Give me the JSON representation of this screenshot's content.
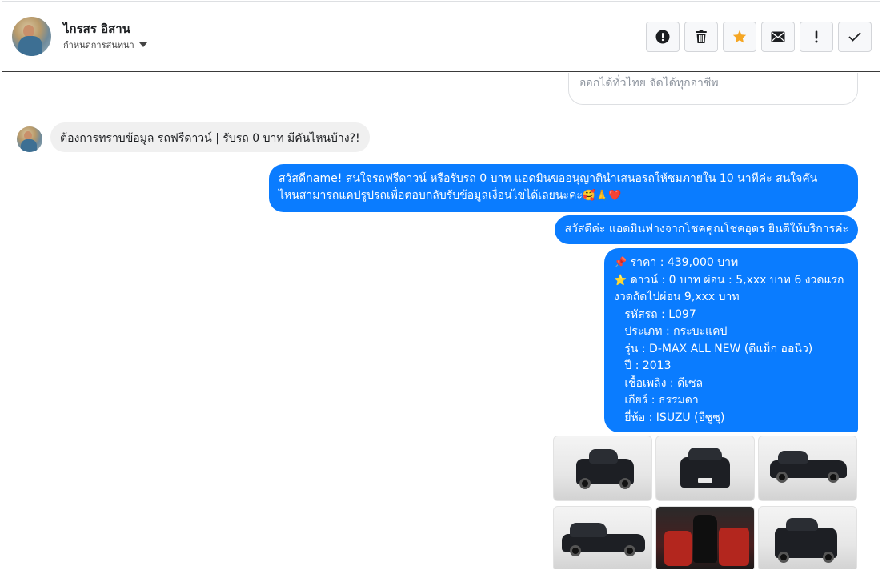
{
  "header": {
    "contact_name": "ไกรสร อิสาน",
    "subtitle": "กำหนดการสนทนา",
    "icons": [
      "alert-circle-icon",
      "trash-icon",
      "star-icon",
      "mail-icon",
      "exclamation-icon",
      "check-icon"
    ],
    "colors": {
      "star": "#f5a623",
      "icon": "#1c1e21"
    }
  },
  "thread": {
    "card_text": "ออกได้ทั่วไทย จัดได้ทุกอาชีพ",
    "incoming": "ต้องการทราบข้อมูล รถฟรีดาวน์ | รับรถ 0 บาท มีคันไหนบ้าง?!",
    "outgoing_1_line1": "สวัสดีname! สนใจรถฟรีดาวน์ หรือรับรถ 0 บาท แอดมินขออนุญาตินำเสนอรถให้ชมภายใน 10 นาทีค่ะ สนใจคัน",
    "outgoing_1_line2": "ไหนสามารถแคปรูปรถเพื่อตอบกลับรับข้อมูลเงื่อนไขได้เลยนะคะ",
    "outgoing_1_emoji": "🥰🙏❤️",
    "outgoing_2": "สวัสดีค่ะ แอดมินฟางจากโชคคูณโชคอุดร ยินดีให้บริการค่ะ",
    "outgoing_3": {
      "pin_emoji": "📌",
      "star_emoji": "⭐",
      "price": " ราคา : 439,000 บาท",
      "down": " ดาวน์ : 0 บาท ผ่อน : 5,xxx บาท 6 งวดแรก",
      "next": " งวดถัดไปผ่อน  9,xxx บาท",
      "code": "   รหัสรถ : L097",
      "type": "   ประเภท : กระบะแคป",
      "model": "   รุ่น : D-MAX ALL NEW (ดีแม็ก ออนิว)",
      "year": "   ปี : 2013",
      "fuel": "   เชื้อเพลิง : ดีเซล",
      "gear": "   เกียร์ : ธรรมดา",
      "brand": "   ยี่ห้อ : ISUZU (อีซูซุ)"
    },
    "colors": {
      "outgoing": "#0a7cff",
      "incoming": "#f0f0f0"
    }
  },
  "photos": [
    "car-front-three-quarter",
    "car-front",
    "car-side-rear",
    "car-side",
    "car-interior",
    "car-front-right"
  ]
}
